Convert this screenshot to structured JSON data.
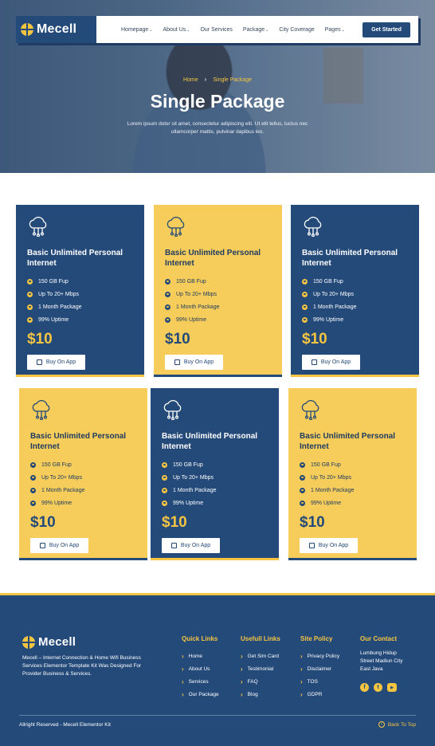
{
  "brand": {
    "name": "Mecell"
  },
  "nav": {
    "items": [
      {
        "label": "Homepage",
        "caret": "⌄"
      },
      {
        "label": "About Us",
        "caret": "⌄"
      },
      {
        "label": "Our Services",
        "caret": ""
      },
      {
        "label": "Package",
        "caret": "⌄"
      },
      {
        "label": "City Coverage",
        "caret": ""
      },
      {
        "label": "Pages",
        "caret": "⌄"
      }
    ],
    "cta": "Get Started"
  },
  "hero": {
    "crumb_home": "Home",
    "crumb_sep": "›",
    "crumb_current": "Single Package",
    "title": "Single Package",
    "description": "Lorem ipsum dolor sit amet, consectetur adipiscing elit. Ut elit tellus, luctus nec ullamcorper mattis, pulvinar dapibus leo."
  },
  "cards": [
    {
      "theme": "blue",
      "title": "Basic Unlimited Personal Internet",
      "features": [
        "150 GB Fup",
        "Up To 20+ Mbps",
        "1 Month Package",
        "99% Uptime"
      ],
      "price": "$10",
      "button": "Buy On App"
    },
    {
      "theme": "yellow",
      "title": "Basic Unlimited Personal Internet",
      "features": [
        "150 GB Fup",
        "Up To 20+ Mbps",
        "1 Month Package",
        "99% Uptime"
      ],
      "price": "$10",
      "button": "Buy On App"
    },
    {
      "theme": "blue",
      "title": "Basic Unlimited Personal Internet",
      "features": [
        "150 GB Fup",
        "Up To 20+ Mbps",
        "1 Month Package",
        "99% Uptime"
      ],
      "price": "$10",
      "button": "Buy On App"
    },
    {
      "theme": "yellow",
      "title": "Basic Unlimited Personal Internet",
      "features": [
        "150 GB Fup",
        "Up To 20+ Mbps",
        "1 Month Package",
        "99% Uptime"
      ],
      "price": "$10",
      "button": "Buy On App"
    },
    {
      "theme": "blue",
      "title": "Basic Unlimited Personal Internet",
      "features": [
        "150 GB Fup",
        "Up To 20+ Mbps",
        "1 Month Package",
        "99% Uptime"
      ],
      "price": "$10",
      "button": "Buy On App"
    },
    {
      "theme": "yellow",
      "title": "Basic Unlimited Personal Internet",
      "features": [
        "150 GB Fup",
        "Up To 20+ Mbps",
        "1 Month Package",
        "99% Uptime"
      ],
      "price": "$10",
      "button": "Buy On App"
    }
  ],
  "footer": {
    "about": "Mecell – Internet Connection & Home Wifi Business Services Elementor Template Kit Was Designed For Provider Business & Services.",
    "quick_links": {
      "heading": "Quick Links",
      "items": [
        "Home",
        "About Us",
        "Services",
        "Our Package"
      ]
    },
    "useful_links": {
      "heading": "Usefull Links",
      "items": [
        "Get Sim Card",
        "Testimonial",
        "FAQ",
        "Blog"
      ]
    },
    "site_policy": {
      "heading": "Site Policy",
      "items": [
        "Privacy Policy",
        "Disclaimer",
        "TOS",
        "GDPR"
      ]
    },
    "contact": {
      "heading": "Our Contact",
      "address": [
        "Lumbung Hidup",
        "Street Madiun City",
        "East Java"
      ]
    },
    "socials": [
      "facebook-icon",
      "twitter-icon",
      "youtube-icon"
    ],
    "copyright": "Allright Reserved - Mecell Elementor Kit",
    "back_to_top": "Back To Top"
  },
  "colors": {
    "navy": "#244a7a",
    "yellow": "#f6cd5a",
    "accent": "#f5c542"
  }
}
